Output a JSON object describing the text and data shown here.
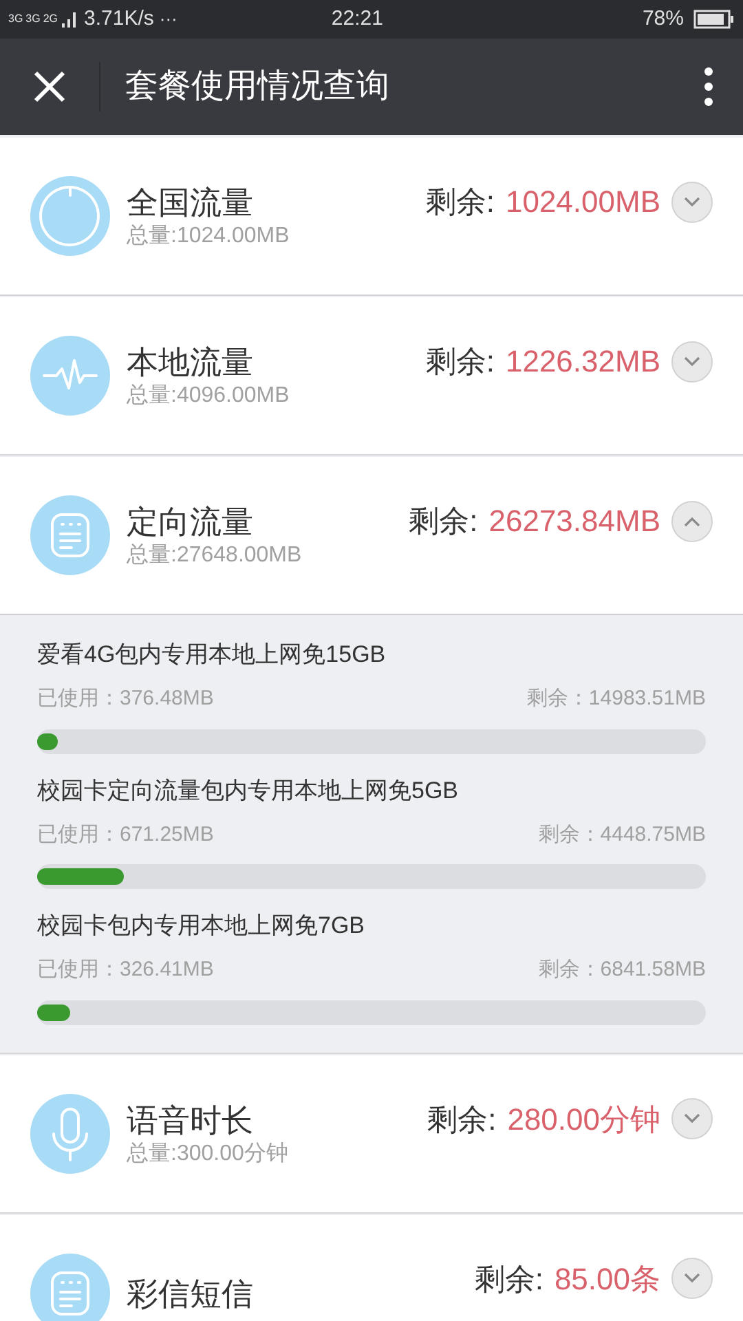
{
  "status_bar": {
    "network": [
      "3G",
      "3G",
      "2G"
    ],
    "speed": "3.71K/s",
    "more": "···",
    "time": "22:21",
    "battery": "78%"
  },
  "header": {
    "title": "套餐使用情况查询"
  },
  "items": [
    {
      "kind": "national",
      "name": "全国流量",
      "total": "总量:1024.00MB",
      "remaining_label": "剩余:",
      "remaining": "1024.00MB",
      "expanded": false
    },
    {
      "kind": "local",
      "name": "本地流量",
      "total": "总量:4096.00MB",
      "remaining_label": "剩余:",
      "remaining": "1226.32MB",
      "expanded": false
    },
    {
      "kind": "directed",
      "name": "定向流量",
      "total": "总量:27648.00MB",
      "remaining_label": "剩余:",
      "remaining": "26273.84MB",
      "expanded": true,
      "packages": [
        {
          "name": "爱看4G包内专用本地上网免15GB",
          "used": "已使用：376.48MB",
          "remaining": "剩余：14983.51MB",
          "level": 0.03
        },
        {
          "name": "校园卡定向流量包内专用本地上网免5GB",
          "used": "已使用：671.25MB",
          "remaining": "剩余：4448.75MB",
          "level": 0.13
        },
        {
          "name": "校园卡包内专用本地上网免7GB",
          "used": "已使用：326.41MB",
          "remaining": "剩余：6841.58MB",
          "level": 0.05
        }
      ]
    },
    {
      "kind": "voice",
      "name": "语音时长",
      "total": "总量:300.00分钟",
      "remaining_label": "剩余:",
      "remaining": "280.00分钟",
      "expanded": false
    },
    {
      "kind": "mms",
      "name": "彩信短信",
      "remaining_label": "剩余:",
      "remaining": "85.00条",
      "expanded": false
    }
  ]
}
